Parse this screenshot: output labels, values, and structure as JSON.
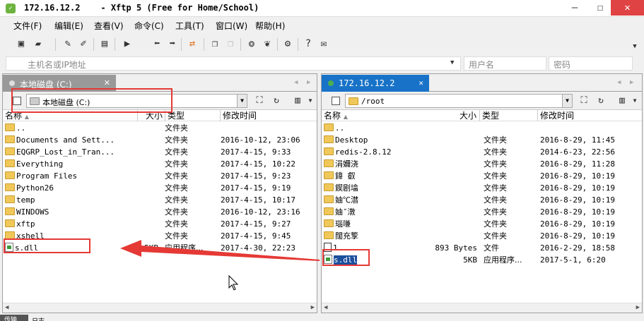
{
  "window": {
    "title": "172.16.12.2    - Xftp 5 (Free for Home/School)",
    "minimize": "—",
    "maximize": "☐",
    "close": "✕"
  },
  "menu": [
    "文件(F)",
    "编辑(E)",
    "查看(V)",
    "命令(C)",
    "工具(T)",
    "窗口(W)",
    "帮助(H)"
  ],
  "address": {
    "host_placeholder": "主机名或IP地址",
    "user_placeholder": "用户名",
    "pass_placeholder": "密码"
  },
  "left_pane": {
    "tab_label": "本地磁盘 (C:)",
    "path": "本地磁盘 (C:)",
    "columns": [
      "名称",
      "大小",
      "类型",
      "修改时间"
    ],
    "rows": [
      {
        "name": "..",
        "size": "",
        "type": "文件夹",
        "modified": "",
        "icon": "folder"
      },
      {
        "name": "Documents and Sett...",
        "size": "",
        "type": "文件夹",
        "modified": "2016-10-12, 23:06",
        "icon": "folder"
      },
      {
        "name": "EQGRP_Lost_in_Tran...",
        "size": "",
        "type": "文件夹",
        "modified": "2017-4-15, 9:33",
        "icon": "folder"
      },
      {
        "name": "Everything",
        "size": "",
        "type": "文件夹",
        "modified": "2017-4-15, 10:22",
        "icon": "folder"
      },
      {
        "name": "Program Files",
        "size": "",
        "type": "文件夹",
        "modified": "2017-4-15, 9:23",
        "icon": "folder"
      },
      {
        "name": "Python26",
        "size": "",
        "type": "文件夹",
        "modified": "2017-4-15, 9:19",
        "icon": "folder"
      },
      {
        "name": "temp",
        "size": "",
        "type": "文件夹",
        "modified": "2017-4-15, 10:17",
        "icon": "folder"
      },
      {
        "name": "WINDOWS",
        "size": "",
        "type": "文件夹",
        "modified": "2016-10-12, 23:16",
        "icon": "folder"
      },
      {
        "name": "xftp",
        "size": "",
        "type": "文件夹",
        "modified": "2017-4-15, 9:27",
        "icon": "folder"
      },
      {
        "name": "xshell",
        "size": "",
        "type": "文件夹",
        "modified": "2017-4-15, 9:45",
        "icon": "folder"
      },
      {
        "name": "s.dll",
        "size": "5KB",
        "type": "应用程序...",
        "modified": "2017-4-30, 22:23",
        "icon": "dll"
      }
    ]
  },
  "right_pane": {
    "tab_label": "172.16.12.2",
    "path": "/root",
    "columns": [
      "名称",
      "大小",
      "类型",
      "修改时间"
    ],
    "rows": [
      {
        "name": "..",
        "size": "",
        "type": "",
        "modified": "",
        "icon": "folder"
      },
      {
        "name": "Desktop",
        "size": "",
        "type": "文件夹",
        "modified": "2016-8-29, 11:45",
        "icon": "folder"
      },
      {
        "name": "redis-2.8.12",
        "size": "",
        "type": "文件夹",
        "modified": "2014-6-23, 22:56",
        "icon": "folder"
      },
      {
        "name": "涓嬭浇",
        "size": "",
        "type": "文件夹",
        "modified": "2016-8-29, 11:28",
        "icon": "folder"
      },
      {
        "name": "鍏 叡",
        "size": "",
        "type": "文件夹",
        "modified": "2016-8-29, 10:19",
        "icon": "folder"
      },
      {
        "name": "鍥剧墖",
        "size": "",
        "type": "文件夹",
        "modified": "2016-8-29, 10:19",
        "icon": "folder"
      },
      {
        "name": "妯℃澘",
        "size": "",
        "type": "文件夹",
        "modified": "2016-8-29, 10:19",
        "icon": "folder"
      },
      {
        "name": "妯″潡",
        "size": "",
        "type": "文件夹",
        "modified": "2016-8-29, 10:19",
        "icon": "folder"
      },
      {
        "name": "瑙嗛",
        "size": "",
        "type": "文件夹",
        "modified": "2016-8-29, 10:19",
        "icon": "folder"
      },
      {
        "name": "闊充箰",
        "size": "",
        "type": "文件夹",
        "modified": "2016-8-29, 10:19",
        "icon": "folder"
      },
      {
        "name": "1",
        "size": "893 Bytes",
        "type": "文件",
        "modified": "2016-2-29, 18:58",
        "icon": "file"
      },
      {
        "name": "s.dll",
        "size": "5KB",
        "type": "应用程序...",
        "modified": "2017-5-1, 6:20",
        "icon": "dll"
      }
    ]
  },
  "bottom": {
    "tab1": "传输",
    "tab2": "日志"
  }
}
